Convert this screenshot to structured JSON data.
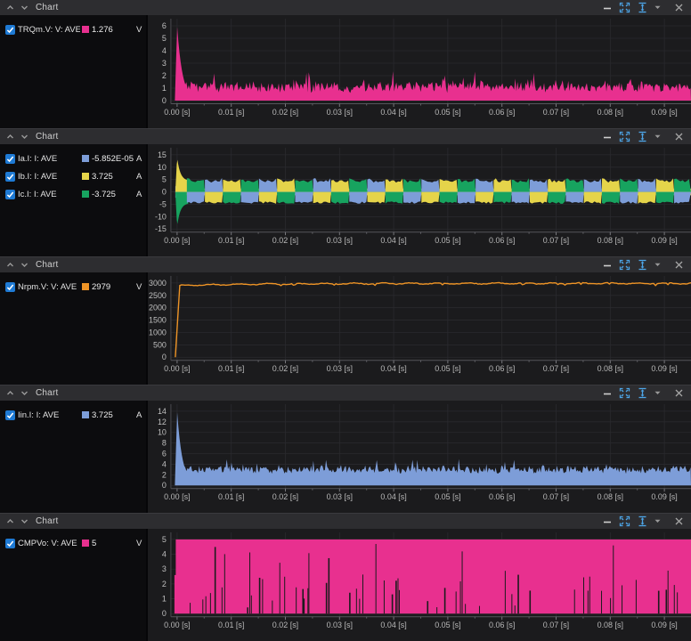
{
  "window": {
    "panel_title": "Chart",
    "controls": [
      {
        "name": "minimize-button",
        "icon": "minimize-icon"
      },
      {
        "name": "fit-to-view-button",
        "icon": "fit-to-view-icon"
      },
      {
        "name": "auto-scale-button",
        "icon": "auto-scale-icon",
        "dropdown": "chevron-down-icon"
      },
      {
        "name": "close-button",
        "icon": "close-icon"
      }
    ]
  },
  "colors": {
    "pink": "#E8308F",
    "blue": "#7D9DD8",
    "yellow": "#E5D44A",
    "green": "#17A35F",
    "orange": "#EE9426",
    "checkbox_blue": "#1E7AD4",
    "icon_blue": "#4DA6E8"
  },
  "panels": [
    {
      "title": "Chart",
      "legend": [
        {
          "label": "TRQm.V: V: AVE",
          "value": "1.276",
          "unit": "V",
          "color": "#E8308F",
          "checked": true
        }
      ],
      "chart_data": {
        "type": "line",
        "xticks": [
          "0.00 [s]",
          "0.01 [s]",
          "0.02 [s]",
          "0.03 [s]",
          "0.04 [s]",
          "0.05 [s]",
          "0.06 [s]",
          "0.07 [s]",
          "0.08 [s]",
          "0.09 [s]"
        ],
        "xtick_interval_s": 0.01,
        "xlim_s": [
          0,
          0.095
        ],
        "yticks": [
          0,
          1,
          2,
          3,
          4,
          5,
          6
        ],
        "ylim": [
          0,
          6.3
        ],
        "grid": true,
        "series": [
          {
            "name": "TRQm.V: V: AVE",
            "color": "#E8308F",
            "fill": true,
            "average": 1.276,
            "waveform": {
              "kind": "spike_decay_band",
              "initial_peak": 6,
              "peak_t_s": 0.0005,
              "steady_level": 1.05,
              "noise_amp": 0.5
            }
          }
        ]
      }
    },
    {
      "title": "Chart",
      "legend": [
        {
          "label": "Ia.I: I: AVE",
          "value": "-5.852E-05",
          "unit": "A",
          "color": "#7D9DD8",
          "checked": true
        },
        {
          "label": "Ib.I: I: AVE",
          "value": "3.725",
          "unit": "A",
          "color": "#E5D44A",
          "checked": true
        },
        {
          "label": "Ic.I: I: AVE",
          "value": "-3.725",
          "unit": "A",
          "color": "#17A35F",
          "checked": true
        }
      ],
      "chart_data": {
        "type": "line",
        "xticks": [
          "0.00 [s]",
          "0.01 [s]",
          "0.02 [s]",
          "0.03 [s]",
          "0.04 [s]",
          "0.05 [s]",
          "0.06 [s]",
          "0.07 [s]",
          "0.08 [s]",
          "0.09 [s]"
        ],
        "xtick_interval_s": 0.01,
        "xlim_s": [
          0,
          0.095
        ],
        "yticks": [
          -15,
          -10,
          -5,
          0,
          5,
          10,
          15
        ],
        "ylim": [
          -16.5,
          16.5
        ],
        "grid": true,
        "series": [
          {
            "name": "Ia.I: I: AVE",
            "color": "#7D9DD8",
            "average": -5.852e-05
          },
          {
            "name": "Ib.I: I: AVE",
            "color": "#E5D44A",
            "average": 3.725
          },
          {
            "name": "Ic.I: I: AVE",
            "color": "#17A35F",
            "average": -3.725
          }
        ],
        "waveform": {
          "kind": "three_phase_square",
          "amplitude": 4.3,
          "ripple": 1.0,
          "block_s": 0.00333,
          "startup_peak": 14,
          "startup_pos_phase": "Ib",
          "startup_neg_phase": "Ic"
        }
      }
    },
    {
      "title": "Chart",
      "legend": [
        {
          "label": "Nrpm.V: V: AVE",
          "value": "2979",
          "unit": "V",
          "color": "#EE9426",
          "checked": true
        }
      ],
      "chart_data": {
        "type": "line",
        "xticks": [
          "0.00 [s]",
          "0.01 [s]",
          "0.02 [s]",
          "0.03 [s]",
          "0.04 [s]",
          "0.05 [s]",
          "0.06 [s]",
          "0.07 [s]",
          "0.08 [s]",
          "0.09 [s]"
        ],
        "xtick_interval_s": 0.01,
        "xlim_s": [
          0,
          0.095
        ],
        "yticks": [
          0,
          500,
          1000,
          1500,
          2000,
          2500,
          3000
        ],
        "ylim": [
          0,
          3150
        ],
        "grid": true,
        "series": [
          {
            "name": "Nrpm.V: V: AVE",
            "color": "#EE9426",
            "fill": false,
            "average": 2979,
            "waveform": {
              "kind": "rise_to_flat_line",
              "rise_time_s": 0.0015,
              "settle_level": 2980,
              "noise_amp": 30
            }
          }
        ]
      }
    },
    {
      "title": "Chart",
      "legend": [
        {
          "label": "Iin.I: I: AVE",
          "value": "3.725",
          "unit": "A",
          "color": "#7D9DD8",
          "checked": true
        }
      ],
      "chart_data": {
        "type": "line",
        "xticks": [
          "0.00 [s]",
          "0.01 [s]",
          "0.02 [s]",
          "0.03 [s]",
          "0.04 [s]",
          "0.05 [s]",
          "0.06 [s]",
          "0.07 [s]",
          "0.08 [s]",
          "0.09 [s]"
        ],
        "xtick_interval_s": 0.01,
        "xlim_s": [
          0,
          0.095
        ],
        "yticks": [
          0,
          2,
          4,
          6,
          8,
          10,
          12,
          14
        ],
        "ylim": [
          0,
          14.7
        ],
        "grid": true,
        "series": [
          {
            "name": "Iin.I: I: AVE",
            "color": "#7D9DD8",
            "fill": true,
            "average": 3.725,
            "waveform": {
              "kind": "spike_decay_band",
              "initial_peak": 14,
              "peak_t_s": 0.0005,
              "steady_level": 2.9,
              "noise_amp": 0.8
            }
          }
        ]
      }
    },
    {
      "title": "Chart",
      "legend": [
        {
          "label": "CMPVo: V: AVE",
          "value": "5",
          "unit": "V",
          "color": "#E8308F",
          "checked": true
        }
      ],
      "chart_data": {
        "type": "line",
        "xticks": [
          "0.00 [s]",
          "0.01 [s]",
          "0.02 [s]",
          "0.03 [s]",
          "0.04 [s]",
          "0.05 [s]",
          "0.06 [s]",
          "0.07 [s]",
          "0.08 [s]",
          "0.09 [s]"
        ],
        "xtick_interval_s": 0.01,
        "xlim_s": [
          0,
          0.095
        ],
        "yticks": [
          0,
          1,
          2,
          3,
          4,
          5
        ],
        "ylim": [
          0,
          5.25
        ],
        "grid": true,
        "series": [
          {
            "name": "CMPVo: V: AVE",
            "color": "#E8308F",
            "fill": true,
            "average": 5,
            "waveform": {
              "kind": "full_band_with_dropouts",
              "band_top": 5,
              "band_bottom": 0,
              "dropout_count": 60
            }
          }
        ]
      }
    }
  ]
}
